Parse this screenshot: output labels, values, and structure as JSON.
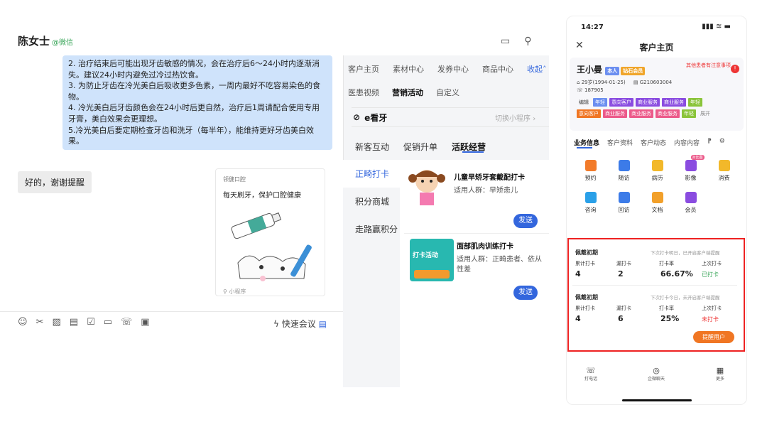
{
  "chat": {
    "contact_name": "陈女士",
    "contact_source": "@微信",
    "message_lines": [
      "2. 治疗结束后可能出现牙齿敏感的情况，会在治疗后6～24小时内逐渐消失。建议24小时内避免过冷过热饮食。",
      "3. 为防止牙齿在冷光美白后吸收更多色素，一周内最好不吃容易染色的食物。",
      "4. 冷光美白后牙齿颜色会在24小时后更自然，治疗后1周请配合使用专用牙膏，美白效果会更理想。",
      "5.冷光美白后要定期检查牙齿和洗牙（每半年），能维持更好牙齿美白效果。"
    ],
    "reply": "好的，谢谢提醒",
    "card": {
      "brand": "领健口腔",
      "title": "每天刷牙，保护口腔健康",
      "footer": "小程序"
    },
    "quick_meeting": "快速会议"
  },
  "panel": {
    "top_tabs": [
      "客户主页",
      "素材中心",
      "发券中心",
      "商品中心"
    ],
    "collapse": "收起",
    "sub_tabs": [
      "医患视频",
      "营销活动",
      "自定义"
    ],
    "brand": "e看牙",
    "switch": "切换小程序",
    "op_tabs": [
      "新客互动",
      "促销升单",
      "活跃经营"
    ],
    "side_items": [
      "正畸打卡",
      "积分商城",
      "走路赢积分"
    ],
    "items": [
      {
        "title": "儿童早矫牙套戴配打卡",
        "sub": "适用人群：早矫患儿",
        "send": "发送"
      },
      {
        "title": "面部肌肉训练打卡",
        "sub": "适用人群：正畸患者、依从性差",
        "send": "发送",
        "img_text": "打卡活动"
      }
    ]
  },
  "phone": {
    "time": "14:27",
    "title": "客户主页",
    "name": "王小曼",
    "tags": [
      "本人",
      "钻石会员"
    ],
    "notice": "其他患者有注意事项",
    "birth": "29岁(1994-01-25)",
    "record_no": "G210603004",
    "phone": "187905",
    "tag_row1": [
      "编辑",
      "年轻",
      "意向客户",
      "商业服务",
      "商业服务",
      "年轻"
    ],
    "tag_row2": [
      "意向客户",
      "商业服务",
      "商业服务",
      "商业服务",
      "年轻",
      "展开"
    ],
    "tabs": [
      "业务信息",
      "客户资料",
      "客户动态",
      "内容内容"
    ],
    "grid": [
      {
        "label": "预约",
        "color": "#f27b2a"
      },
      {
        "label": "随访",
        "color": "#3c7be8"
      },
      {
        "label": "病历",
        "color": "#f2b82a"
      },
      {
        "label": "影像",
        "color": "#8a4ce0",
        "badge": "对比图"
      },
      {
        "label": "消费",
        "color": "#f2b82a"
      },
      {
        "label": "咨询",
        "color": "#2aa0e8"
      },
      {
        "label": "回访",
        "color": "#3c7be8"
      },
      {
        "label": "文档",
        "color": "#f2a02a"
      },
      {
        "label": "会员",
        "color": "#8a4ce0"
      }
    ],
    "checkin": [
      {
        "name": "佩戴初期",
        "hint": "下次打卡明日，已开启客户端提醒",
        "h1": "累计打卡",
        "h2": "漏打卡",
        "h3": "打卡率",
        "h4": "上次打卡",
        "v1": "4",
        "v2": "2",
        "v3": "66.67%",
        "v4": "已打卡",
        "v4color": "#3aa65a"
      },
      {
        "name": "佩戴初期",
        "hint": "下次打卡今日，未开启客户端提醒",
        "h1": "累计打卡",
        "h2": "漏打卡",
        "h3": "打卡率",
        "h4": "上次打卡",
        "v1": "4",
        "v2": "6",
        "v3": "25%",
        "v4": "未打卡",
        "v4color": "#e33"
      }
    ],
    "remind": "提醒用户",
    "bottom": [
      "打电话",
      "企微聊天",
      "更多"
    ]
  }
}
